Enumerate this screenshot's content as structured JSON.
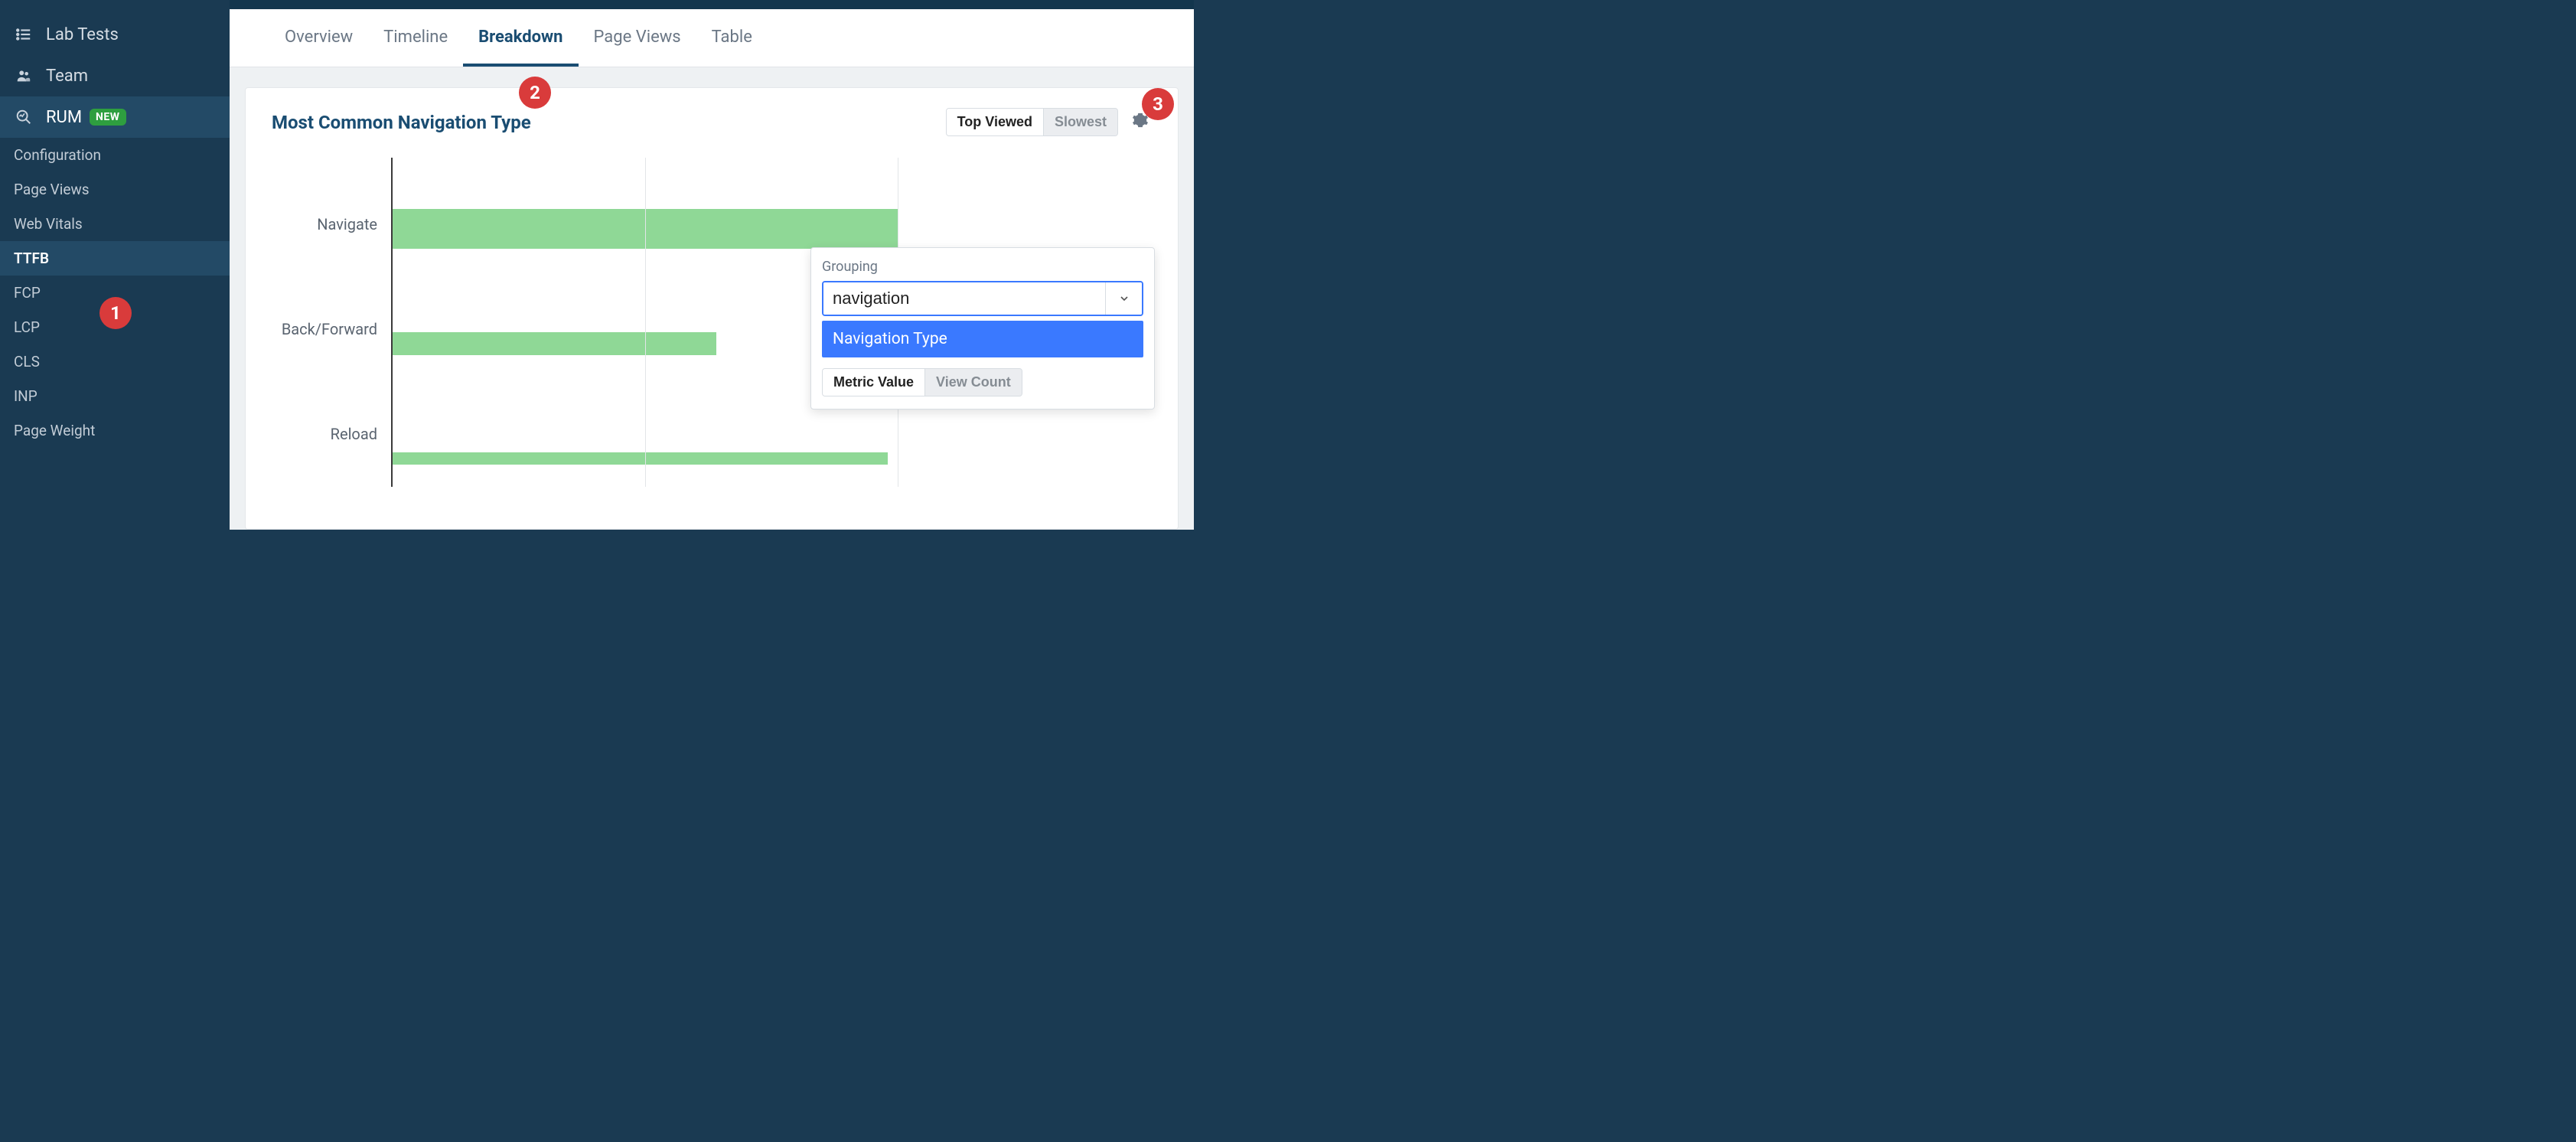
{
  "sidebar": {
    "lab_tests": "Lab Tests",
    "team": "Team",
    "rum": "RUM",
    "rum_badge": "NEW",
    "sub": {
      "configuration": "Configuration",
      "page_views": "Page Views",
      "web_vitals": "Web Vitals",
      "ttfb": "TTFB",
      "fcp": "FCP",
      "lcp": "LCP",
      "cls": "CLS",
      "inp": "INP",
      "page_weight": "Page Weight"
    }
  },
  "tabs": {
    "overview": "Overview",
    "timeline": "Timeline",
    "breakdown": "Breakdown",
    "page_views": "Page Views",
    "table": "Table"
  },
  "panel": {
    "title": "Most Common Navigation Type",
    "toggle_top_viewed": "Top Viewed",
    "toggle_slowest": "Slowest"
  },
  "popover": {
    "grouping_label": "Grouping",
    "grouping_value": "navigation",
    "grouping_option": "Navigation Type",
    "metric_value": "Metric Value",
    "view_count": "View Count"
  },
  "annotations": {
    "a1": "1",
    "a2": "2",
    "a3": "3"
  },
  "chart_data": {
    "type": "bar",
    "orientation": "horizontal",
    "categories": [
      "Navigate",
      "Back/Forward",
      "Reload"
    ],
    "values": [
      100,
      64,
      98
    ],
    "title": "Most Common Navigation Type",
    "xlabel": "",
    "ylabel": "",
    "xlim": [
      0,
      100
    ],
    "bar_color": "#8fd896",
    "note": "values are relative percentages estimated from visible bar lengths; only partial chart visible"
  }
}
